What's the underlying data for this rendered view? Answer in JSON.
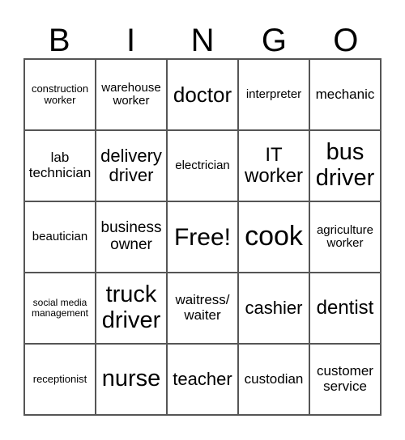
{
  "header": [
    "B",
    "I",
    "N",
    "G",
    "O"
  ],
  "cells": [
    [
      "construction worker",
      "warehouse worker",
      "doctor",
      "interpreter",
      "mechanic"
    ],
    [
      "lab technician",
      "delivery driver",
      "electrician",
      "IT worker",
      "bus driver"
    ],
    [
      "beautician",
      "business owner",
      "Free!",
      "cook",
      "agriculture worker"
    ],
    [
      "social media management",
      "truck driver",
      "waitress/ waiter",
      "cashier",
      "dentist"
    ],
    [
      "receptionist",
      "nurse",
      "teacher",
      "custodian",
      "customer service"
    ]
  ]
}
